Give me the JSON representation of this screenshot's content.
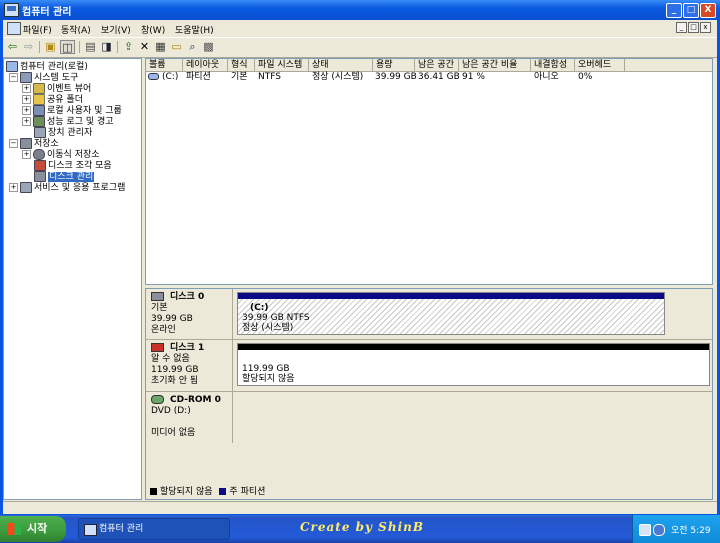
{
  "window": {
    "title": "컴퓨터 관리",
    "controls": {
      "minimize": "_",
      "maximize": "□",
      "close": "X"
    }
  },
  "menu": {
    "items": [
      "파일(F)",
      "동작(A)",
      "보기(V)",
      "창(W)",
      "도움말(H)"
    ],
    "inner_controls": [
      "_",
      "□",
      "x"
    ]
  },
  "toolbar": {
    "buttons": [
      "back-icon",
      "forward-icon",
      "up-icon",
      "show-hide-tree-icon",
      "properties-icon",
      "help-icon",
      "export-icon",
      "delete-icon",
      "properties2-icon",
      "open-icon",
      "search-icon",
      "settings-icon"
    ]
  },
  "tree": {
    "root": "컴퓨터 관리(로컬)",
    "system_tools": "시스템 도구",
    "event_viewer": "이벤트 뷰어",
    "shared_folders": "공유 폴더",
    "local_users": "로컬 사용자 및 그룹",
    "perf_logs": "성능 로그 및 경고",
    "device_manager": "장치 관리자",
    "storage": "저장소",
    "removable_storage": "이동식 저장소",
    "defrag": "디스크 조각 모음",
    "disk_management": "디스크 관리",
    "services": "서비스 및 응용 프로그램"
  },
  "volumes": {
    "columns": [
      "볼륨",
      "레이아웃",
      "형식",
      "파일 시스템",
      "상태",
      "용량",
      "남은 공간",
      "남은 공간 비율",
      "내결함성",
      "오버헤드"
    ],
    "rows": [
      {
        "volume": "(C:)",
        "layout": "파티션",
        "type": "기본",
        "fs": "NTFS",
        "status": "정상 (시스템)",
        "capacity": "39.99 GB",
        "free": "36.41 GB",
        "free_pct": "91 %",
        "fault": "아니오",
        "overhead": "0%"
      }
    ]
  },
  "disks": [
    {
      "name": "디스크 0",
      "type": "기본",
      "size": "39.99 GB",
      "status": "온라인",
      "partition": {
        "label": "(C:)",
        "size_fs": "39.99 GB NTFS",
        "status": "정상 (시스템)"
      }
    },
    {
      "name": "디스크 1",
      "type": "알 수 없음",
      "size": "119.99 GB",
      "status": "초기화 안 됨",
      "partition": {
        "size": "119.99 GB",
        "status": "할당되지 않음"
      }
    },
    {
      "name": "CD-ROM 0",
      "type": "DVD (D:)",
      "size": "",
      "status": "미디어 없음"
    }
  ],
  "legend": {
    "unallocated": "할당되지 않음",
    "primary": "주 파티션"
  },
  "colors": {
    "unallocated": "#000000",
    "primary": "#0a0a84",
    "selection": "#316ac5"
  },
  "taskbar": {
    "start": "시작",
    "task": "컴퓨터 관리",
    "brand": "Create by ShinB",
    "clock": "오전 5:29"
  }
}
